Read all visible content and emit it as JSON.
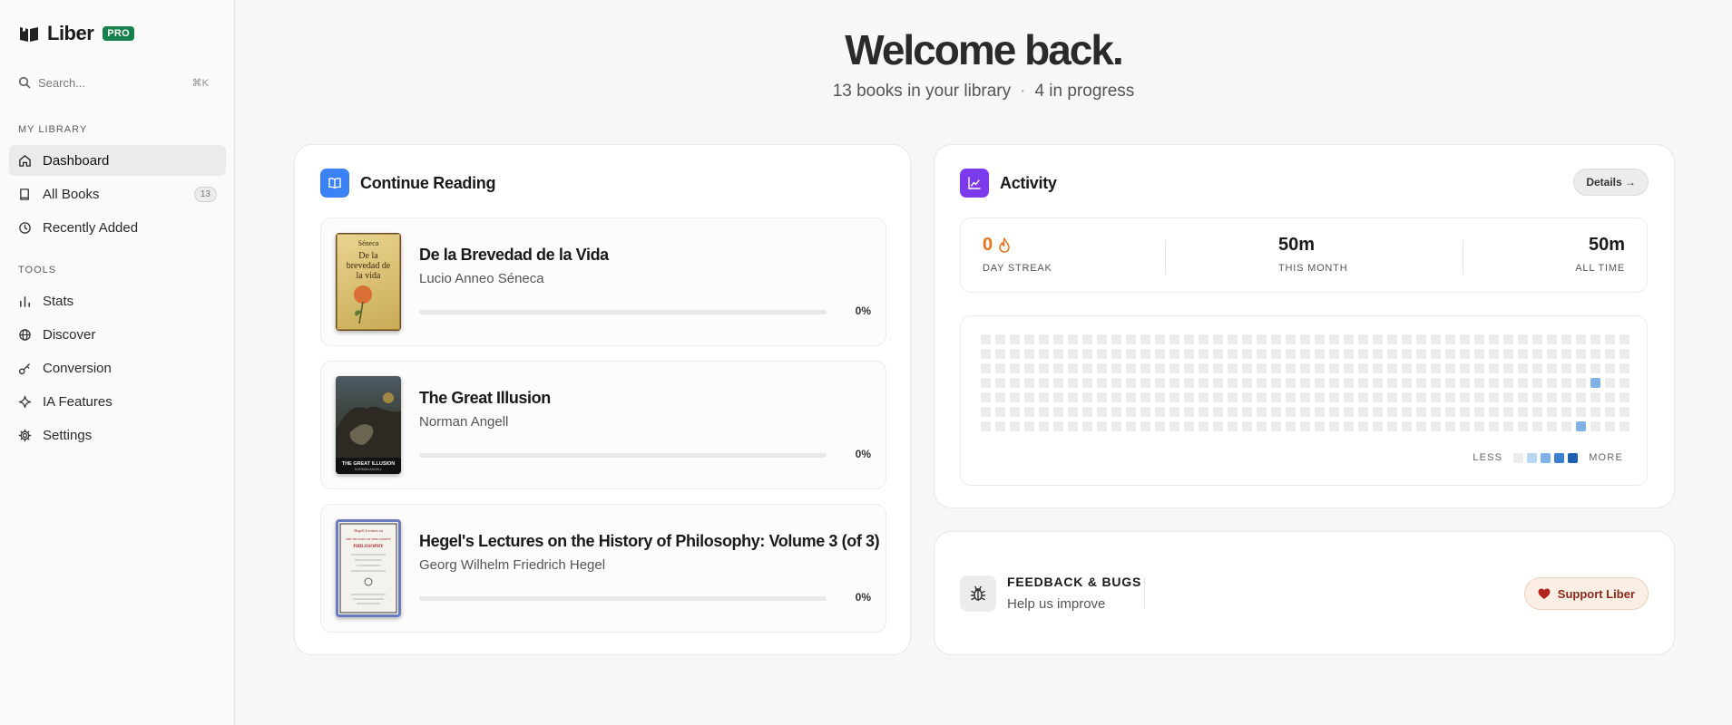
{
  "brand": {
    "name": "Liber",
    "badge": "PRO"
  },
  "search": {
    "placeholder": "Search...",
    "shortcut": "⌘K"
  },
  "sidebar": {
    "sections": [
      {
        "label": "MY LIBRARY"
      },
      {
        "label": "TOOLS"
      }
    ],
    "items": [
      {
        "label": "Dashboard",
        "icon": "home-icon",
        "active": true
      },
      {
        "label": "All Books",
        "icon": "book-icon",
        "count": "13"
      },
      {
        "label": "Recently Added",
        "icon": "clock-icon"
      },
      {
        "label": "Stats",
        "icon": "bar-chart-icon"
      },
      {
        "label": "Discover",
        "icon": "globe-icon"
      },
      {
        "label": "Conversion",
        "icon": "key-icon"
      },
      {
        "label": "IA Features",
        "icon": "sparkle-icon"
      },
      {
        "label": "Settings",
        "icon": "gear-icon"
      }
    ]
  },
  "header": {
    "title": "Welcome back.",
    "books_count": "13 books in your library",
    "separator": "·",
    "in_progress": "4 in progress"
  },
  "continue_reading": {
    "title": "Continue Reading",
    "books": [
      {
        "title": "De la Brevedad de la Vida",
        "author": "Lucio Anneo Séneca",
        "progress": 0,
        "progress_label": "0%",
        "cover": {
          "line1": "Séneca",
          "line2": "De la brevedad de la vida"
        }
      },
      {
        "title": "The Great Illusion",
        "author": "Norman Angell",
        "progress": 0,
        "progress_label": "0%",
        "cover": {
          "line1": "THE GREAT ILLUSION",
          "line2": "NORMAN ANGELL"
        }
      },
      {
        "title": "Hegel's Lectures on the History of Philosophy: Volume 3 (of 3)",
        "author": "Georg Wilhelm Friedrich Hegel",
        "progress": 0,
        "progress_label": "0%",
        "cover": {
          "line1": "Hegel's Lectures on",
          "line2": "THE HISTORY OF PHILOSOPHY"
        }
      }
    ]
  },
  "activity": {
    "title": "Activity",
    "details_label": "Details →",
    "streak": {
      "value": "0",
      "label": "DAY STREAK"
    },
    "month": {
      "value": "50m",
      "label": "THIS MONTH"
    },
    "all_time": {
      "value": "50m",
      "label": "ALL TIME"
    },
    "legend_less": "LESS",
    "legend_more": "MORE",
    "legend_colors": [
      "#ececec",
      "#b9d7f3",
      "#7fb3e8",
      "#3b7fd0",
      "#1f5fae"
    ],
    "heatmap": {
      "weeks": 45,
      "days": 7,
      "active": [
        [
          42,
          3
        ],
        [
          41,
          6
        ]
      ]
    }
  },
  "feedback": {
    "title": "FEEDBACK & BUGS",
    "subtitle": "Help us improve",
    "support_label": "Support Liber"
  },
  "colors": {
    "accent_blue": "#3b82f6",
    "accent_purple": "#7c3aed",
    "streak_orange": "#e8731a",
    "pro_green": "#14804a"
  }
}
